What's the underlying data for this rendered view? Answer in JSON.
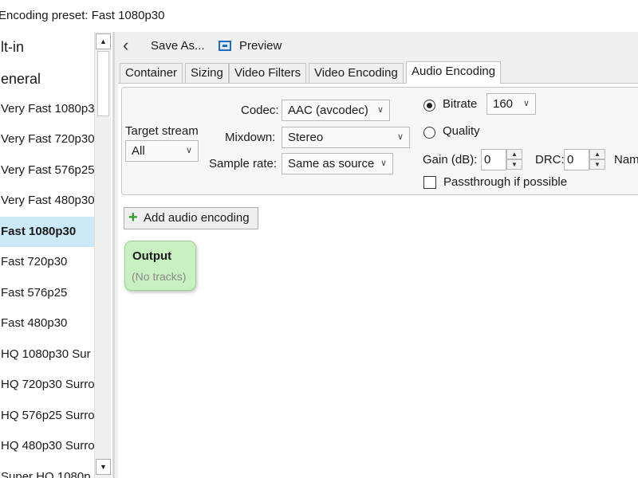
{
  "window": {
    "title": "Encoding preset: Fast 1080p30"
  },
  "presets": {
    "items": [
      {
        "label": "lt-in",
        "type": "group"
      },
      {
        "label": "eneral",
        "type": "group"
      },
      {
        "label": "Very Fast 1080p3",
        "type": "item"
      },
      {
        "label": "Very Fast 720p30",
        "type": "item"
      },
      {
        "label": "Very Fast 576p25",
        "type": "item"
      },
      {
        "label": "Very Fast 480p30",
        "type": "item"
      },
      {
        "label": "Fast 1080p30",
        "type": "item",
        "selected": true
      },
      {
        "label": "Fast 720p30",
        "type": "item"
      },
      {
        "label": "Fast 576p25",
        "type": "item"
      },
      {
        "label": "Fast 480p30",
        "type": "item"
      },
      {
        "label": "HQ 1080p30 Sur",
        "type": "item"
      },
      {
        "label": "HQ 720p30 Surro",
        "type": "item"
      },
      {
        "label": "HQ 576p25 Surro",
        "type": "item"
      },
      {
        "label": "HQ 480p30 Surro",
        "type": "item"
      },
      {
        "label": "Super HQ 1080p",
        "type": "item"
      }
    ],
    "selected_color": "#cde8f6"
  },
  "toolbar": {
    "save_as": "Save As...",
    "preview": "Preview"
  },
  "tabs": [
    "Container",
    "Sizing",
    "Video Filters",
    "Video Encoding",
    "Audio Encoding"
  ],
  "active_tab": "Audio Encoding",
  "audio": {
    "target_stream_label": "Target stream",
    "target_stream_value": "All",
    "codec_label": "Codec:",
    "codec_value": "AAC (avcodec)",
    "mixdown_label": "Mixdown:",
    "mixdown_value": "Stereo",
    "sample_rate_label": "Sample rate:",
    "sample_rate_value": "Same as source",
    "bitrate_label": "Bitrate",
    "bitrate_value": "160",
    "bitrate_selected": true,
    "quality_label": "Quality",
    "gain_label": "Gain (dB):",
    "gain_value": "0",
    "drc_label": "DRC:",
    "drc_value": "0",
    "name_label": "Nam",
    "passthrough_label": "Passthrough if possible",
    "passthrough_checked": false
  },
  "actions": {
    "add_audio_encoding": "Add audio encoding"
  },
  "output": {
    "title": "Output",
    "subtitle": "(No tracks)",
    "card_color": "#c8f0c0"
  }
}
